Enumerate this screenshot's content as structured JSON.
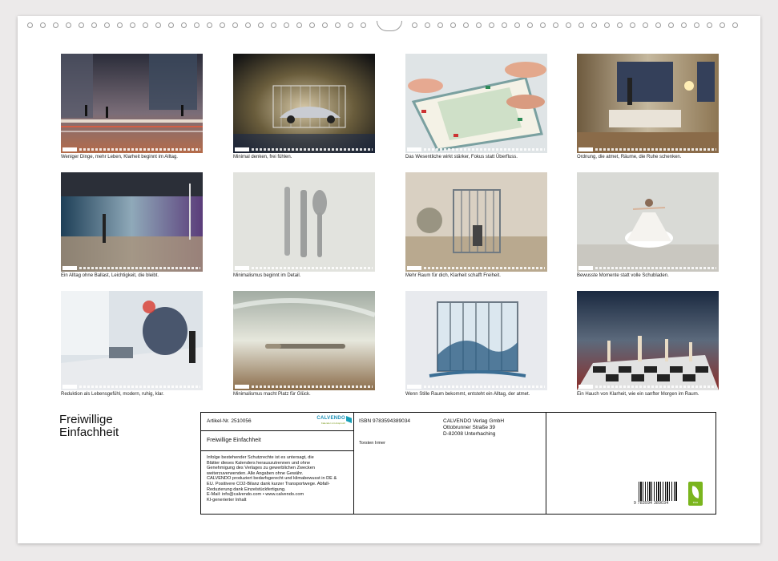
{
  "calendar": {
    "title_lines": [
      "Freiwillige",
      "Einfachheit"
    ]
  },
  "months": [
    {
      "label": "Januar",
      "caption": "Weniger Dinge, mehr Leben, Klarheit beginnt im Alltag."
    },
    {
      "label": "Februar",
      "caption": "Minimal denken, frei fühlen."
    },
    {
      "label": "März",
      "caption": "Das Wesentliche wirkt stärker, Fokus statt Überfluss."
    },
    {
      "label": "April",
      "caption": "Ordnung, die atmet, Räume, die Ruhe schenken."
    },
    {
      "label": "Mai",
      "caption": "Ein Alltag ohne Ballast, Leichtigkeit, die bleibt."
    },
    {
      "label": "Juni",
      "caption": "Minimalismus beginnt im Detail."
    },
    {
      "label": "Juli",
      "caption": "Mehr Raum für dich, Klarheit schafft Freiheit."
    },
    {
      "label": "August",
      "caption": "Bewusste Momente statt volle Schubladen."
    },
    {
      "label": "September",
      "caption": "Reduktion als Lebensgefühl, modern, ruhig, klar."
    },
    {
      "label": "Oktober",
      "caption": "Minimalismus macht Platz für Glück."
    },
    {
      "label": "November",
      "caption": "Wenn Stille Raum bekommt, entsteht ein Alltag, der atmet."
    },
    {
      "label": "Dezember",
      "caption": "Ein Hauch von Klarheit, wie ein sanfter Morgen im Raum."
    }
  ],
  "info_box": {
    "article": "Artikel-Nr. 2510056",
    "brand": "CALVENDO",
    "brand_tagline": "Kalender mit Anspruch",
    "product_title": "Freiwillige Einfachheit",
    "legal_lines": [
      "Infolge bestehender Schutzrechte ist es untersagt, die",
      "Blätter dieses Kalenders herauszutrennen und ohne",
      "Genehmigung des Verlages zu gewerblichen Zwecken",
      "weiterzuverwenden. Alle Angaben ohne Gewähr.",
      "CALVENDO produziert bedarfsgerecht und klimabewusst in DE &",
      "EU. Positivere CO2-Bilanz dank kurzer Transportwege. Abfall-",
      "Reduzierung dank Einzelstückfertigung.",
      "E-Mail: info@calvendo.com • www.calvendo.com",
      "KI-generierter Inhalt"
    ],
    "isbn": "ISBN 9783594389034",
    "author": "Torsten Irmer",
    "publisher_lines": [
      "CALVENDO Verlag GmbH",
      "Ottobrunner Straße 39",
      "D-82008 Unterhaching"
    ],
    "barcode_number": "9 783594 389034",
    "eco_label": "eco"
  }
}
